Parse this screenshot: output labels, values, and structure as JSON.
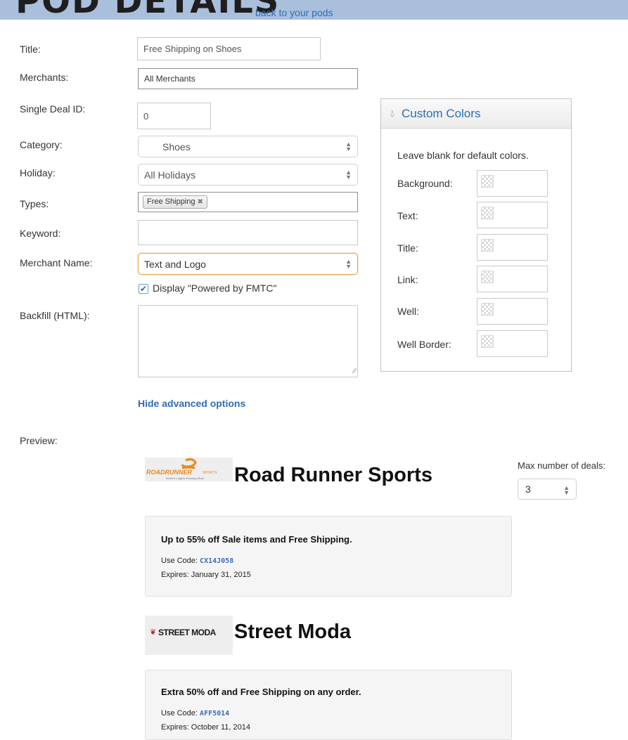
{
  "header": {
    "title": "POD DETAILS",
    "back_link": "back to your pods"
  },
  "form": {
    "title_label": "Title:",
    "title_value": "Free Shipping on Shoes",
    "merchants_label": "Merchants:",
    "merchants_value": "All Merchants",
    "deal_id_label": "Single Deal ID:",
    "deal_id_value": "0",
    "category_label": "Category:",
    "category_value": "Shoes",
    "holiday_label": "Holiday:",
    "holiday_value": "All Holidays",
    "types_label": "Types:",
    "types_tag": "Free Shipping",
    "keyword_label": "Keyword:",
    "keyword_value": "",
    "merchant_name_label": "Merchant Name:",
    "merchant_name_value": "Text and Logo",
    "powered_checkbox_label": "Display \"Powered by FMTC\"",
    "powered_checked": true,
    "backfill_label": "Backfill (HTML):",
    "backfill_value": "",
    "advanced_link": "Hide advanced options"
  },
  "custom_colors": {
    "title": "Custom Colors",
    "hint": "Leave blank for default colors.",
    "fields": [
      {
        "label": "Background:"
      },
      {
        "label": "Text:"
      },
      {
        "label": "Title:"
      },
      {
        "label": "Link:"
      },
      {
        "label": "Well:"
      },
      {
        "label": "Well Border:"
      }
    ]
  },
  "preview": {
    "label": "Preview:",
    "max_deals_label": "Max number of deals:",
    "max_deals_value": "3",
    "merchants": [
      {
        "name": "Road Runner Sports",
        "logo_text": "ROADRUNNER",
        "logo_small": "SPORTS",
        "logo_tagline": "World's Largest Running Store",
        "deal_title": "Up to 55% off Sale items and Free Shipping.",
        "code_label": "Use Code:",
        "code": "CX14J058",
        "expires": "Expires: January 31, 2015"
      },
      {
        "name": "Street Moda",
        "logo_text": "STREET MODA",
        "deal_title": "Extra 50% off and Free Shipping on any order.",
        "code_label": "Use Code:",
        "code": "AFF5014",
        "expires": "Expires: October 11, 2014"
      }
    ]
  },
  "colors": {
    "link": "#2f6db3",
    "header_band": "#a9bfdc",
    "focus_border": "#e6a14a",
    "deal_well": "#f5f5f5"
  }
}
